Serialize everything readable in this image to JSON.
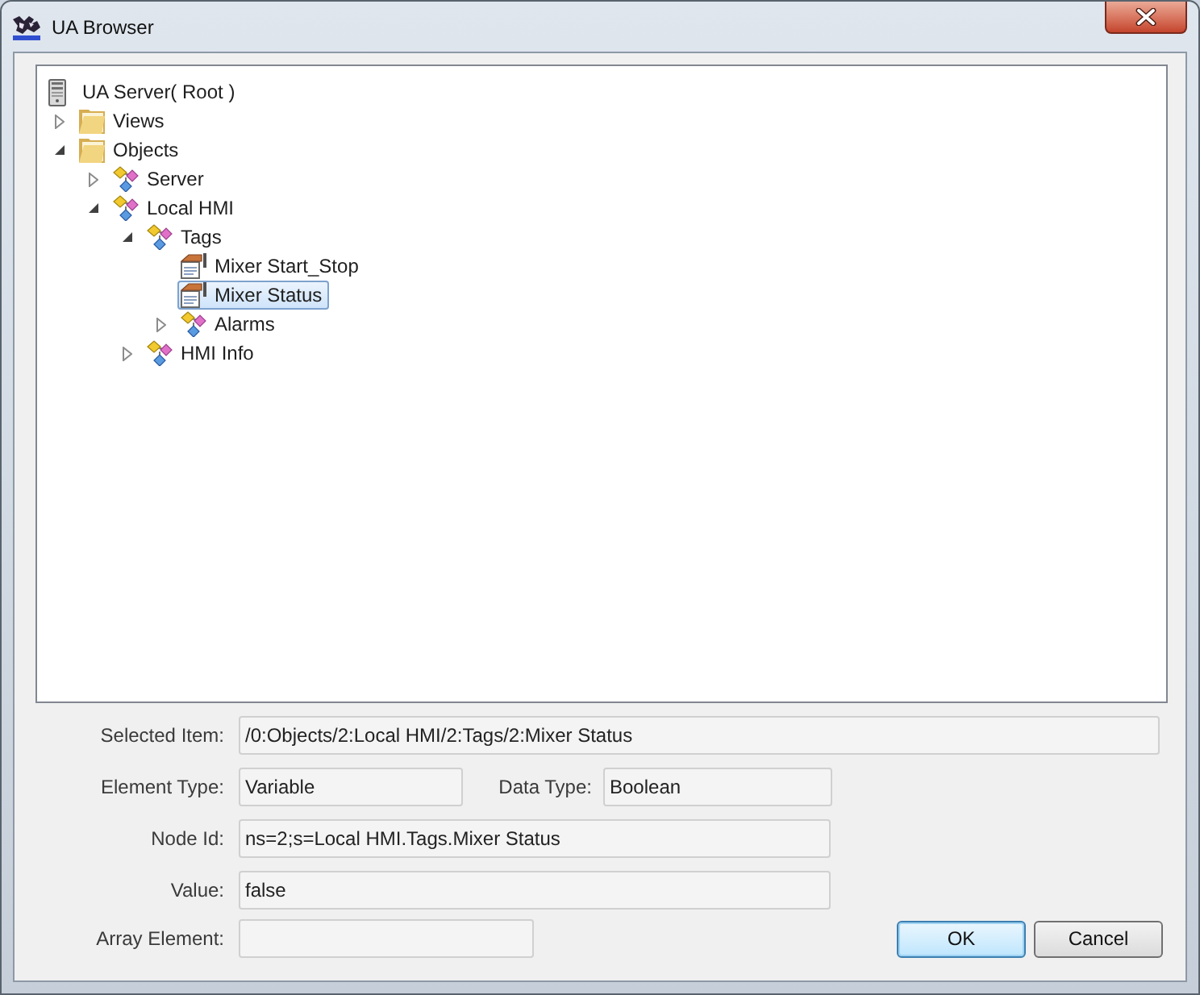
{
  "window": {
    "title": "UA Browser"
  },
  "tree": [
    {
      "label": "UA Server( Root )",
      "kind": "server",
      "selected": false,
      "children": [
        {
          "label": "Views",
          "kind": "folder",
          "expanded": false,
          "selected": false
        },
        {
          "label": "Objects",
          "kind": "folder",
          "expanded": true,
          "selected": false,
          "children": [
            {
              "label": "Server",
              "kind": "object",
              "expanded": false,
              "selected": false
            },
            {
              "label": "Local HMI",
              "kind": "object",
              "expanded": true,
              "selected": false,
              "children": [
                {
                  "label": "Tags",
                  "kind": "object",
                  "expanded": true,
                  "selected": false,
                  "children": [
                    {
                      "label": "Mixer Start_Stop",
                      "kind": "variable",
                      "selected": false
                    },
                    {
                      "label": "Mixer Status",
                      "kind": "variable",
                      "selected": true
                    },
                    {
                      "label": "Alarms",
                      "kind": "object",
                      "expanded": false,
                      "selected": false
                    }
                  ]
                },
                {
                  "label": "HMI Info",
                  "kind": "object",
                  "expanded": false,
                  "selected": false
                }
              ]
            }
          ]
        }
      ]
    }
  ],
  "details": {
    "selected_item": {
      "label": "Selected Item:",
      "value": "/0:Objects/2:Local HMI/2:Tags/2:Mixer Status"
    },
    "element_type": {
      "label": "Element Type:",
      "value": "Variable"
    },
    "data_type": {
      "label": "Data Type:",
      "value": "Boolean"
    },
    "node_id": {
      "label": "Node Id:",
      "value": "ns=2;s=Local HMI.Tags.Mixer Status"
    },
    "value": {
      "label": "Value:",
      "value": "false"
    },
    "array_element": {
      "label": "Array Element:"
    }
  },
  "buttons": [
    {
      "label": "OK",
      "default": true
    },
    {
      "label": "Cancel",
      "default": false
    }
  ]
}
